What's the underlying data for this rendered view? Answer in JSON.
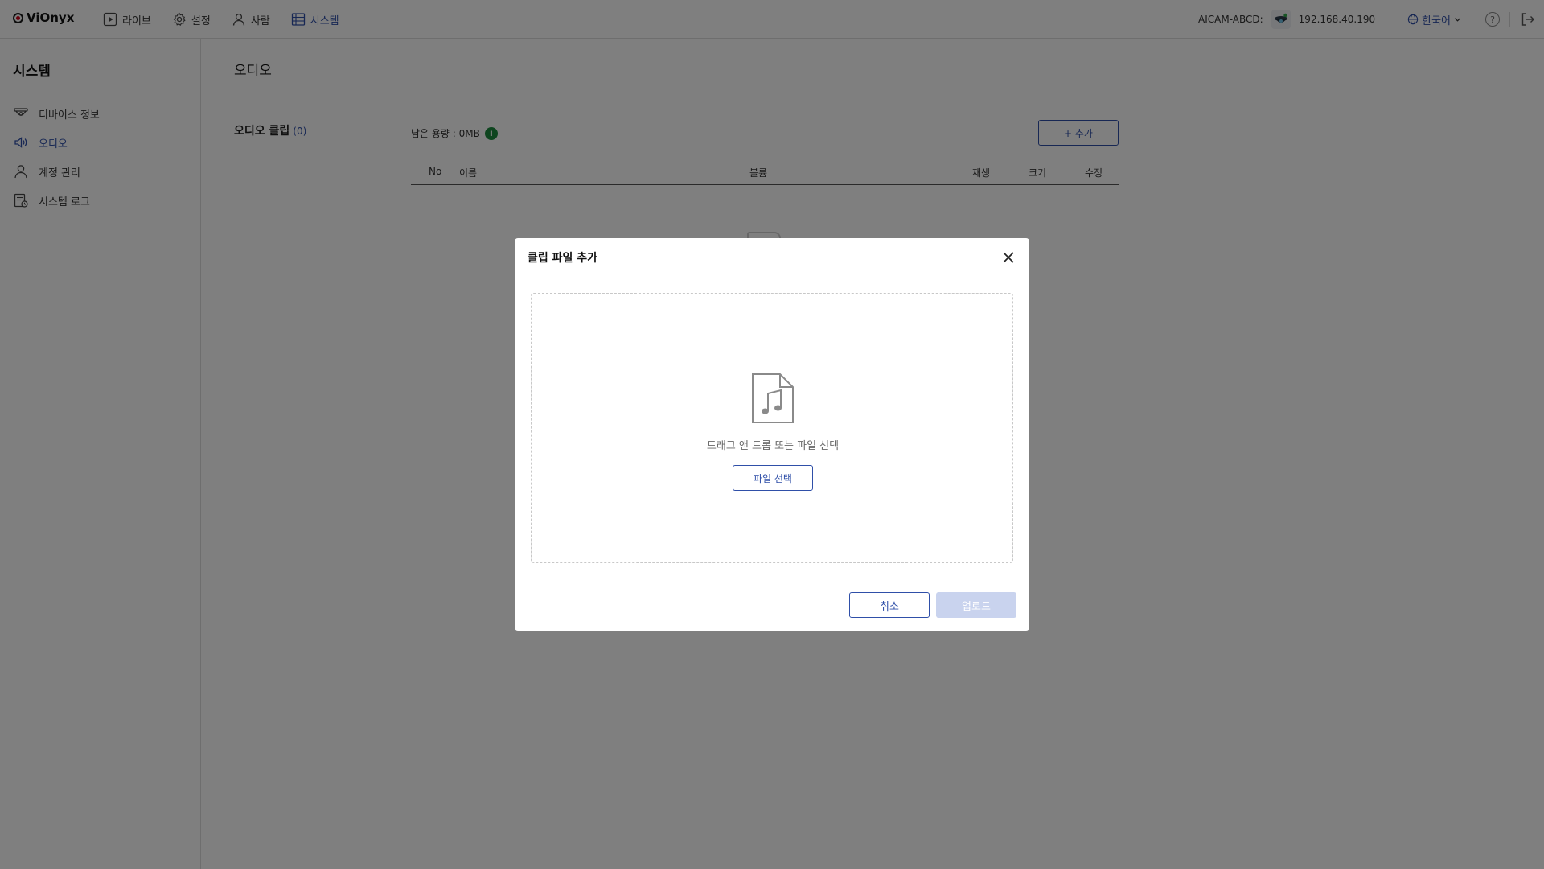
{
  "app": {
    "name": "ViOnyx"
  },
  "nav": {
    "items": [
      {
        "label": "라이브",
        "icon": "play-icon"
      },
      {
        "label": "설정",
        "icon": "gear-icon"
      },
      {
        "label": "사람",
        "icon": "person-icon"
      },
      {
        "label": "시스템",
        "icon": "system-grid-icon",
        "active": true
      }
    ]
  },
  "header": {
    "device_name": "AICAM-ABCD:",
    "device_ip": "192.168.40.190",
    "language": "한국어",
    "help_label": "?"
  },
  "sidebar": {
    "title": "시스템",
    "items": [
      {
        "label": "디바이스 정보",
        "icon": "camera-dome-icon"
      },
      {
        "label": "오디오",
        "icon": "speaker-icon",
        "active": true
      },
      {
        "label": "계정 관리",
        "icon": "user-icon"
      },
      {
        "label": "시스템 로그",
        "icon": "log-file-icon"
      }
    ]
  },
  "main": {
    "page_title": "오디오",
    "section_title": "오디오 클립",
    "section_count": "(0)",
    "capacity_label": "남은 용량 : 0MB",
    "add_button": "+ 추가",
    "table_headers": {
      "no": "No",
      "name": "이름",
      "volume": "볼륨",
      "play": "재생",
      "size": "크기",
      "edit": "수정"
    }
  },
  "modal": {
    "title": "클립 파일 추가",
    "drop_text": "드래그 앤 드롭 또는 파일 선택",
    "file_select_button": "파일 선택",
    "cancel_button": "취소",
    "upload_button": "업로드"
  },
  "colors": {
    "accent": "#2f4fa8",
    "info": "#1d8a3e",
    "upload_disabled": "#c9d3ee",
    "brand_red": "#d0021b"
  }
}
